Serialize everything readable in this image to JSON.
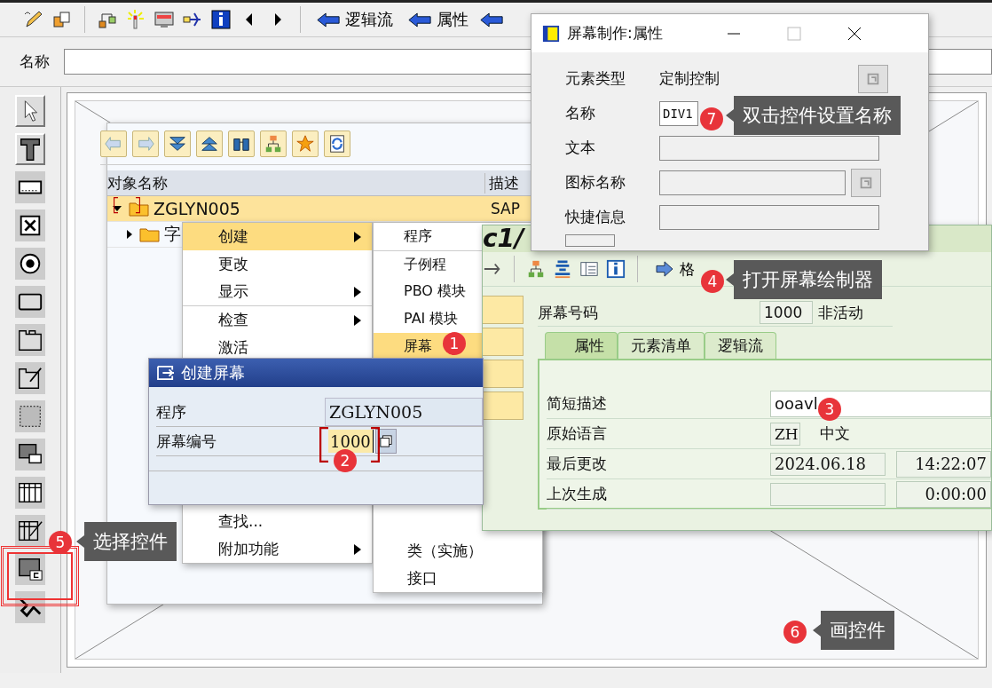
{
  "toolbar": {
    "buttons": [
      {
        "label": "逻辑流"
      },
      {
        "label": "属性"
      }
    ]
  },
  "name_row": {
    "label": "名称"
  },
  "palette": {
    "tools": [
      {
        "kind": "pointer",
        "pressed": true
      },
      {
        "kind": "text",
        "pressed": true
      },
      {
        "kind": "input",
        "pressed": false
      },
      {
        "kind": "checkbox",
        "pressed": false
      },
      {
        "kind": "radio",
        "pressed": false
      },
      {
        "kind": "pushbutton",
        "pressed": false
      },
      {
        "kind": "tabstrip",
        "pressed": false
      },
      {
        "kind": "wizard",
        "pressed": false
      },
      {
        "kind": "box",
        "pressed": false
      },
      {
        "kind": "subscreen",
        "pressed": false
      },
      {
        "kind": "table",
        "pressed": false
      },
      {
        "kind": "tablewizard",
        "pressed": false
      },
      {
        "kind": "custom",
        "pressed": false
      },
      {
        "kind": "status",
        "pressed": false
      }
    ]
  },
  "navigator": {
    "columns": [
      "对象名称",
      "描述"
    ],
    "rows": [
      {
        "name": "ZGLYN005",
        "description": "SAP",
        "expanded": true,
        "selected": true,
        "children": [
          {
            "name": "字",
            "expanded": false
          }
        ]
      }
    ]
  },
  "context_menu": {
    "items": [
      {
        "label": "创建",
        "submenu": true,
        "selected": true,
        "separator": false
      },
      {
        "label": "更改",
        "submenu": false,
        "selected": false,
        "separator": false
      },
      {
        "label": "显示",
        "submenu": true,
        "selected": false,
        "separator": false
      },
      {
        "label": "检查",
        "submenu": true,
        "selected": false,
        "separator": true
      },
      {
        "label": "激活",
        "submenu": false,
        "selected": false,
        "separator": false
      }
    ],
    "items_below": [
      {
        "label": "查找...",
        "submenu": false,
        "selected": false,
        "separator": false
      },
      {
        "label": "附加功能",
        "submenu": true,
        "selected": false,
        "separator": false
      }
    ]
  },
  "submenu": {
    "items": [
      {
        "label": "程序",
        "selected": false,
        "separator": false
      },
      {
        "label": "子例程",
        "selected": false,
        "separator": true
      },
      {
        "label": "PBO 模块",
        "selected": false,
        "separator": false
      },
      {
        "label": "PAI 模块",
        "selected": false,
        "separator": false
      },
      {
        "label": "屏幕",
        "selected": true,
        "separator": false
      }
    ],
    "items_below": [
      {
        "label": "类（实施）",
        "selected": false,
        "separator": false
      },
      {
        "label": "接口",
        "selected": false,
        "separator": false
      }
    ]
  },
  "screen_window": {
    "title": "c1/",
    "toolbar_button": "格",
    "screen_number": {
      "label": "屏幕号码",
      "value": "1000",
      "status": "非活动"
    },
    "tabs": [
      {
        "label": "属性",
        "selected": true
      },
      {
        "label": "元素清单",
        "selected": false
      },
      {
        "label": "逻辑流",
        "selected": false
      }
    ],
    "rows": [
      {
        "kind": "input",
        "label": "简短描述",
        "value": "ooavl"
      },
      {
        "kind": "code",
        "label": "原始语言",
        "code": "ZH",
        "text": "中文"
      },
      {
        "kind": "datetime",
        "label": "最后更改",
        "date": "2024.06.18",
        "time": "14:22:07"
      },
      {
        "kind": "datetime",
        "label": "上次生成",
        "time": "0:00:00"
      }
    ]
  },
  "create_dialog": {
    "title": "创建屏幕",
    "fields": [
      {
        "kind": "display",
        "label": "程序",
        "value": "ZGLYN005"
      },
      {
        "kind": "input",
        "label": "屏幕编号",
        "value": "1000"
      }
    ]
  },
  "properties_dialog": {
    "title": "屏幕制作:属性",
    "rows": [
      {
        "kind": "text",
        "label": "元素类型",
        "value": "定制控制",
        "button": true
      },
      {
        "kind": "field",
        "label": "名称",
        "value": "DIV1",
        "button": false
      },
      {
        "kind": "field",
        "label": "文本",
        "button": false
      },
      {
        "kind": "field",
        "label": "图标名称",
        "button": true
      },
      {
        "kind": "field",
        "label": "快捷信息",
        "button": false
      }
    ]
  },
  "annotations": [
    {
      "number": "7",
      "text": "双击控件设置名称",
      "highlight": false
    },
    {
      "number": "4",
      "text": "打开屏幕绘制器",
      "highlight": false
    },
    {
      "number": "1",
      "highlight": false
    },
    {
      "number": "3",
      "highlight": false
    },
    {
      "number": "2",
      "highlight": false
    },
    {
      "number": "5",
      "text": "选择控件",
      "highlight": true
    },
    {
      "number": "6",
      "text": "画控件",
      "highlight": false
    }
  ]
}
